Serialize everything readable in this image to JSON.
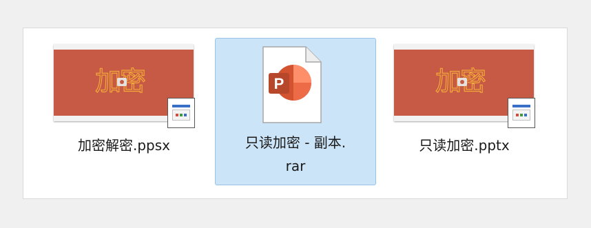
{
  "files": [
    {
      "name": "加密解密.ppsx",
      "thumb_title": "加密",
      "selected": false
    },
    {
      "name": "只读加密 - 副本.\nrar",
      "app_letter": "P",
      "selected": true
    },
    {
      "name": "只读加密.pptx",
      "thumb_title": "加密",
      "selected": false
    }
  ],
  "colors": {
    "thumb_red": "#c65a45",
    "thumb_text": "#f3a93a",
    "selection_bg": "#cce4f7",
    "selection_border": "#99c2e6",
    "powerpoint_orange": "#d35230",
    "powerpoint_dark": "#b7472a"
  },
  "icons": [
    "slide-thumbnail",
    "document-overlay-icon",
    "powerpoint-icon"
  ]
}
